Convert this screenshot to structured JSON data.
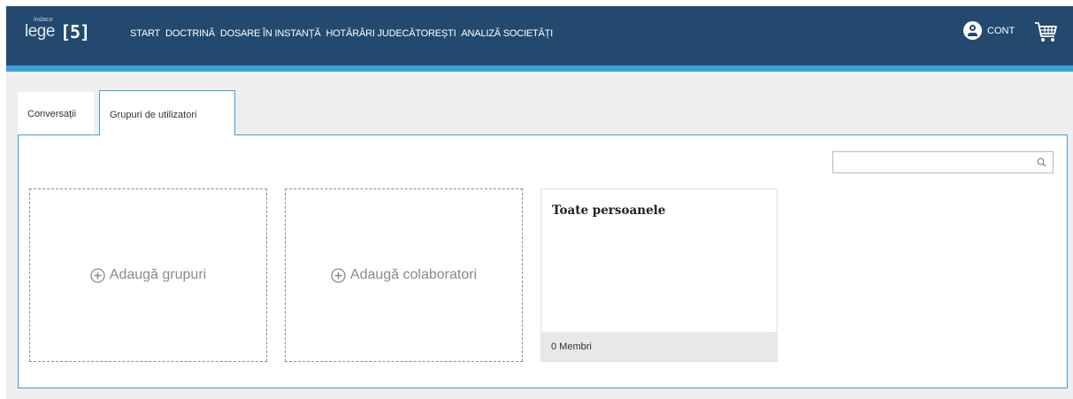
{
  "brand": {
    "logo_small": "indaco",
    "logo_main": "lege",
    "logo_edition": "[5]"
  },
  "nav": {
    "items": [
      {
        "label": "START"
      },
      {
        "label": "DOCTRINĂ"
      },
      {
        "label": "DOSARE ÎN INSTANȚĂ"
      },
      {
        "label": "HOTĂRÂRI JUDECĂTOREȘTI"
      },
      {
        "label": "ANALIZĂ SOCIETĂȚI"
      }
    ]
  },
  "account": {
    "label": "CONT",
    "icon": "user-circle-icon"
  },
  "cart": {
    "icon": "shopping-cart-icon"
  },
  "tabs": [
    {
      "label": "Conversații",
      "active": false
    },
    {
      "label": "Grupuri de utilizatori",
      "active": true
    }
  ],
  "search": {
    "value": "",
    "placeholder": "",
    "icon": "search-icon"
  },
  "actions": {
    "add_groups_label": "Adaugă grupuri",
    "add_collaborators_label": "Adaugă colaboratori"
  },
  "groups": [
    {
      "name": "Toate persoanele",
      "members": "0 Membri"
    }
  ],
  "colors": {
    "header": "#23496e",
    "accent": "#3f9fd8",
    "background": "#efefef"
  }
}
